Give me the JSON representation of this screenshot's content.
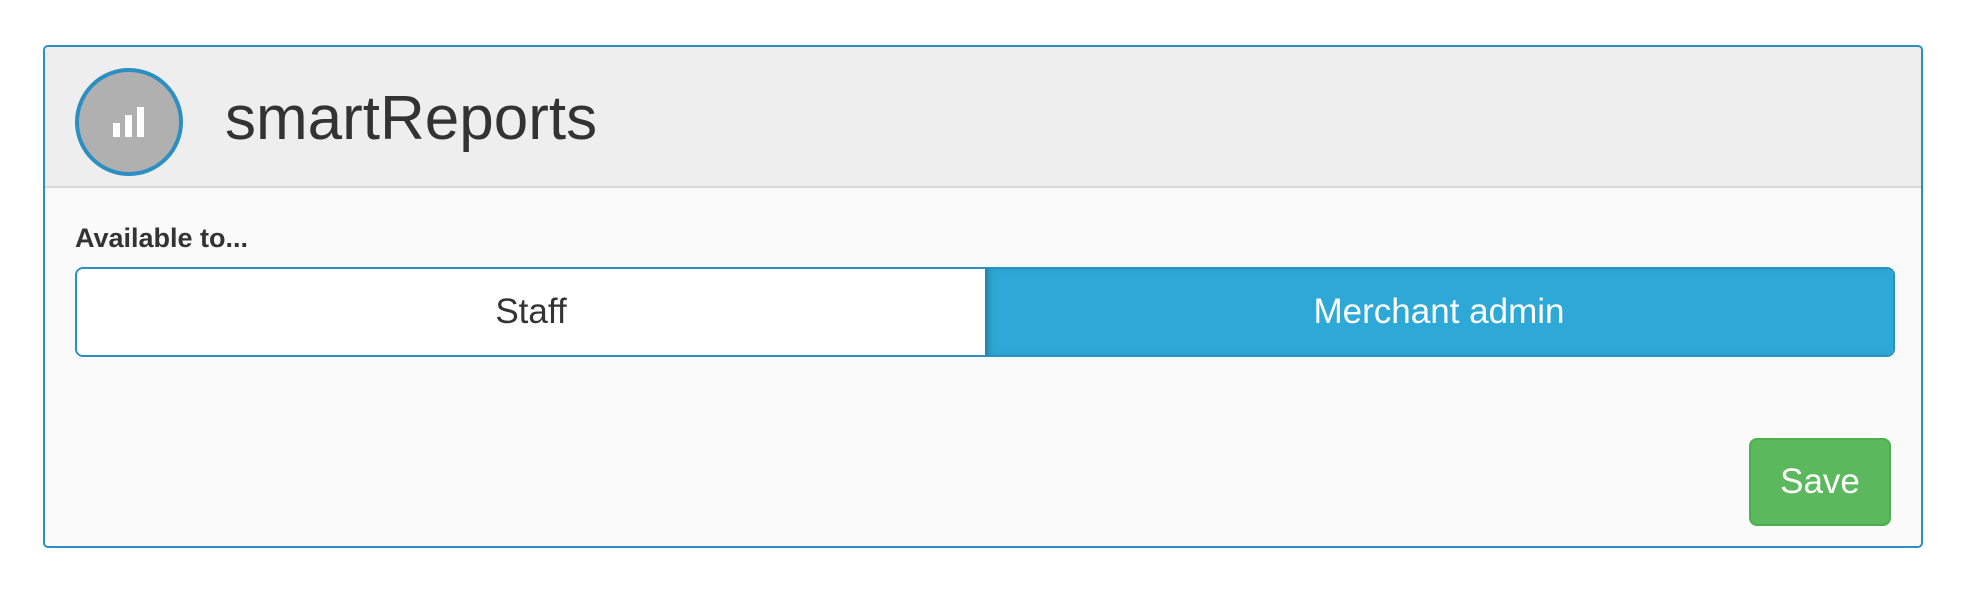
{
  "app": {
    "title": "smartReports",
    "icon": "bar-chart-icon"
  },
  "availability": {
    "label": "Available to...",
    "options": [
      {
        "label": "Staff",
        "selected": false
      },
      {
        "label": "Merchant admin",
        "selected": true
      }
    ]
  },
  "actions": {
    "save_label": "Save"
  },
  "colors": {
    "accent": "#2ea8d6",
    "border": "#2b8fc2",
    "save": "#5cb85c",
    "header_bg": "#eeeeee"
  }
}
